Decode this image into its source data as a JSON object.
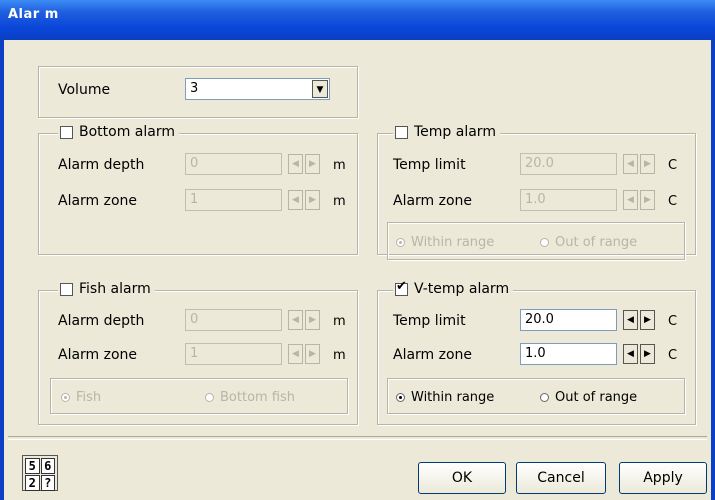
{
  "window": {
    "title": "Alar m"
  },
  "volume": {
    "label": "Volume",
    "value": "3"
  },
  "bottom_alarm": {
    "title": "Bottom alarm",
    "checked": false,
    "depth_label": "Alarm depth",
    "depth_value": "0",
    "depth_unit": "m",
    "zone_label": "Alarm zone",
    "zone_value": "1",
    "zone_unit": "m"
  },
  "temp_alarm": {
    "title": "Temp alarm",
    "checked": false,
    "limit_label": "Temp limit",
    "limit_value": "20.0",
    "limit_unit": "C",
    "zone_label": "Alarm zone",
    "zone_value": "1.0",
    "zone_unit": "C",
    "radio_within": "Within range",
    "radio_out": "Out of range"
  },
  "fish_alarm": {
    "title": "Fish alarm",
    "checked": false,
    "depth_label": "Alarm depth",
    "depth_value": "0",
    "depth_unit": "m",
    "zone_label": "Alarm zone",
    "zone_value": "1",
    "zone_unit": "m",
    "radio_fish": "Fish",
    "radio_bottom_fish": "Bottom fish"
  },
  "vtemp_alarm": {
    "title": "V-temp alarm",
    "checked": true,
    "limit_label": "Temp limit",
    "limit_value": "20.0",
    "limit_unit": "C",
    "zone_label": "Alarm zone",
    "zone_value": "1.0",
    "zone_unit": "C",
    "radio_within": "Within range",
    "radio_out": "Out of range"
  },
  "buttons": {
    "ok": "OK",
    "cancel": "Cancel",
    "apply": "Apply"
  },
  "status_icon": {
    "digits": [
      "5",
      "6",
      "2",
      "?"
    ]
  },
  "colors": {
    "titlebar": "#0a46d8",
    "dialog_bg": "#ECE9D8",
    "field_border": "#7f9db9"
  }
}
